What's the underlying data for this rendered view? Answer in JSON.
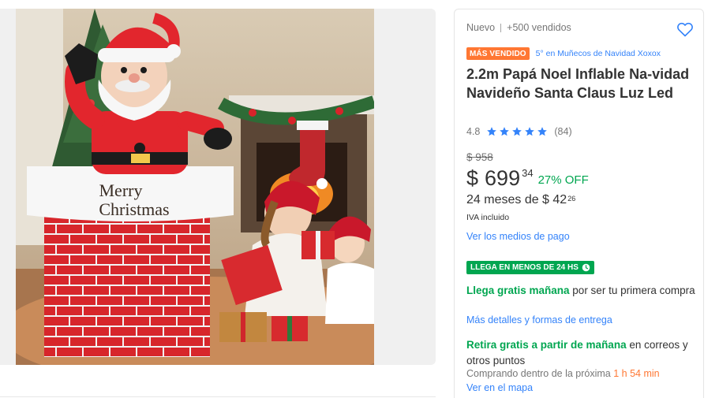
{
  "product": {
    "condition": "Nuevo",
    "sold": "+500 vendidos",
    "best_seller_badge": "MÁS VENDIDO",
    "ranking": "5° en Muñecos de Navidad Xoxox",
    "title": "2.2m Papá Noel Inflable Na-vidad Navideño Santa Claus Luz Led",
    "image_text_line1": "Merry",
    "image_text_line2": "Christmas"
  },
  "rating": {
    "score": "4.8",
    "stars": 5,
    "count": "(84)"
  },
  "pricing": {
    "original_price": "$ 958",
    "currency": "$",
    "amount": "699",
    "cents": "34",
    "discount": "27% OFF",
    "installments_text": "24 meses de $ 42",
    "installments_cents": "26",
    "tax_note": "IVA incluido",
    "payment_link": "Ver los medios de pago"
  },
  "shipping": {
    "fast_badge": "LLEGA EN MENOS DE 24 HS",
    "free_tomorrow": "Llega gratis mañana",
    "free_tomorrow_rest": " por ser tu primera compra",
    "details_link": "Más detalles y formas de entrega",
    "pickup_green": "Retira gratis a partir de mañana",
    "pickup_rest": " en correos y otros puntos",
    "countdown_prefix": "Comprando dentro de la próxima ",
    "countdown_time": "1 h 54 min",
    "map_link": "Ver en el mapa"
  },
  "colors": {
    "accent_blue": "#3483fa",
    "green": "#00a650",
    "orange": "#ff7733"
  },
  "icons": [
    "heart-icon",
    "star-icon",
    "clock-icon"
  ]
}
